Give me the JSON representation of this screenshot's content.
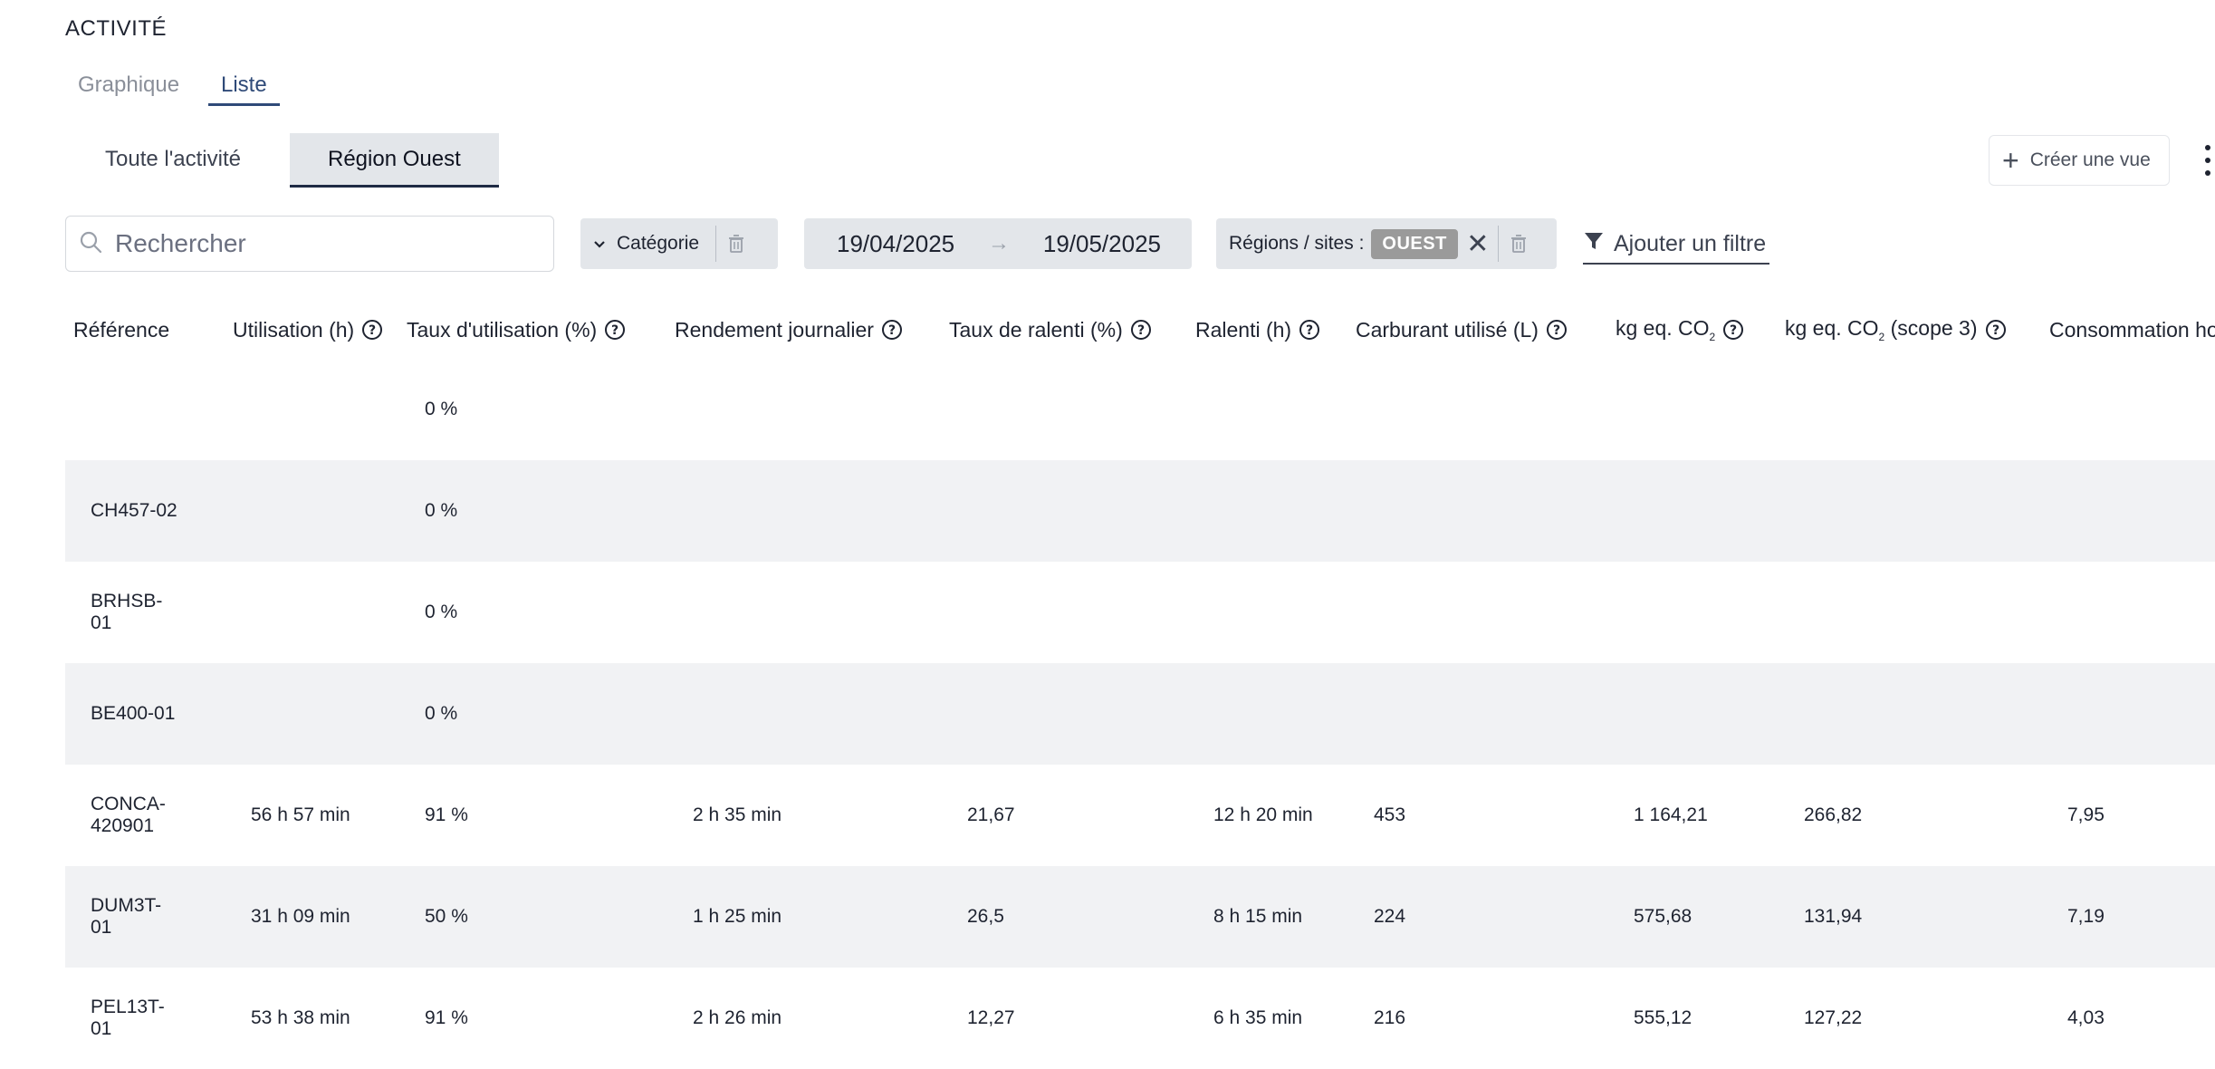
{
  "page": {
    "title": "ACTIVITÉ"
  },
  "view_tabs": [
    {
      "label": "Graphique",
      "active": false
    },
    {
      "label": "Liste",
      "active": true
    }
  ],
  "saved_views": [
    {
      "label": "Toute l'activité",
      "active": false
    },
    {
      "label": "Région Ouest",
      "active": true
    }
  ],
  "toolbar": {
    "create_view_label": "Créer une vue",
    "more_icon": "more-vertical-icon"
  },
  "filters": {
    "search_placeholder": "Rechercher",
    "category_label": "Catégorie",
    "date_from": "19/04/2025",
    "date_arrow": "→",
    "date_to": "19/05/2025",
    "region_prefix": "Régions / sites :",
    "region_value": "OUEST",
    "add_filter_label": "Ajouter un filtre"
  },
  "table": {
    "columns": [
      "Référence",
      "Utilisation (h)",
      "Taux d'utilisation (%)",
      "Rendement journalier",
      "Taux de ralenti (%)",
      "Ralenti (h)",
      "Carburant utilisé (L)",
      "kg eq. CO",
      "kg eq. CO",
      "Consommation ho"
    ],
    "co2_subscript": "2",
    "scope3_suffix": " (scope 3)",
    "rows": [
      [
        "",
        "",
        "0 %",
        "",
        "",
        "",
        "",
        "",
        "",
        ""
      ],
      [
        "CH457-02",
        "",
        "0 %",
        "",
        "",
        "",
        "",
        "",
        "",
        ""
      ],
      [
        "BRHSB-01",
        "",
        "0 %",
        "",
        "",
        "",
        "",
        "",
        "",
        ""
      ],
      [
        "BE400-01",
        "",
        "0 %",
        "",
        "",
        "",
        "",
        "",
        "",
        ""
      ],
      [
        "CONCA-420901",
        "56 h 57 min",
        "91 %",
        "2 h 35 min",
        "21,67",
        "12 h 20 min",
        "453",
        "1 164,21",
        "266,82",
        "7,95"
      ],
      [
        "DUM3T-01",
        "31 h 09 min",
        "50 %",
        "1 h 25 min",
        "26,5",
        "8 h 15 min",
        "224",
        "575,68",
        "131,94",
        "7,19"
      ],
      [
        "PEL13T-01",
        "53 h 38 min",
        "91 %",
        "2 h 26 min",
        "12,27",
        "6 h 35 min",
        "216",
        "555,12",
        "127,22",
        "4,03"
      ]
    ]
  },
  "colors": {
    "accent": "#2f4a78",
    "row_alt": "#f1f2f4",
    "chip_bg": "#e3e6ea",
    "badge_bg": "#9a9a9a"
  }
}
